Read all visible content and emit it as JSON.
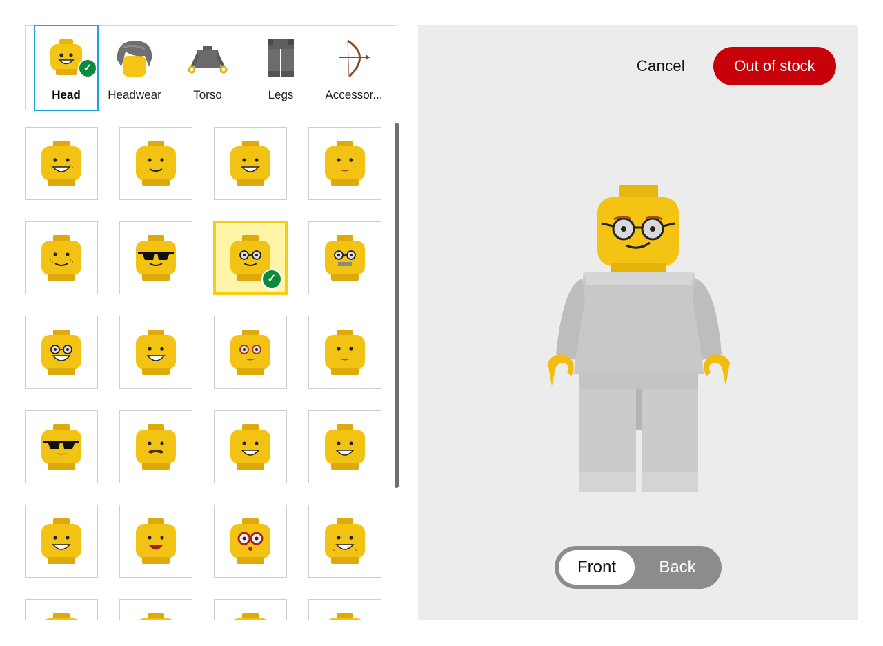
{
  "tabs": [
    {
      "label": "Head",
      "selected": true,
      "icon": "head-icon"
    },
    {
      "label": "Headwear",
      "selected": false,
      "icon": "hair-icon"
    },
    {
      "label": "Torso",
      "selected": false,
      "icon": "torso-icon"
    },
    {
      "label": "Legs",
      "selected": false,
      "icon": "legs-icon"
    },
    {
      "label": "Accessor...",
      "selected": false,
      "icon": "bow-icon"
    }
  ],
  "grid": {
    "selected_index": 6,
    "heads": [
      {
        "face": "freckles-grin"
      },
      {
        "face": "smile"
      },
      {
        "face": "lipstick-smile"
      },
      {
        "face": "lashes-smirk"
      },
      {
        "face": "freckles-smile"
      },
      {
        "face": "sunglasses"
      },
      {
        "face": "glasses"
      },
      {
        "face": "glasses-beard"
      },
      {
        "face": "glasses-grin"
      },
      {
        "face": "big-grin"
      },
      {
        "face": "red-glasses"
      },
      {
        "face": "smirk-lips"
      },
      {
        "face": "sunglasses-lips"
      },
      {
        "face": "moustache"
      },
      {
        "face": "open-smile"
      },
      {
        "face": "teeth-grin"
      },
      {
        "face": "smile-teeth"
      },
      {
        "face": "tongue"
      },
      {
        "face": "goggles-red"
      },
      {
        "face": "stubble-laugh"
      },
      {
        "face": "partial"
      },
      {
        "face": "partial"
      },
      {
        "face": "partial"
      },
      {
        "face": "partial"
      }
    ]
  },
  "preview": {
    "cancel_label": "Cancel",
    "stock_label": "Out of stock",
    "view_front": "Front",
    "view_back": "Back",
    "active_view": "Front"
  },
  "colors": {
    "accent_blue": "#1fa3dc",
    "stock_red": "#c8000a",
    "check_green": "#0b8a3e",
    "selected_yellow": "#fff4a8",
    "lego_yellow": "#f3c314",
    "preview_bg": "#ececec"
  }
}
